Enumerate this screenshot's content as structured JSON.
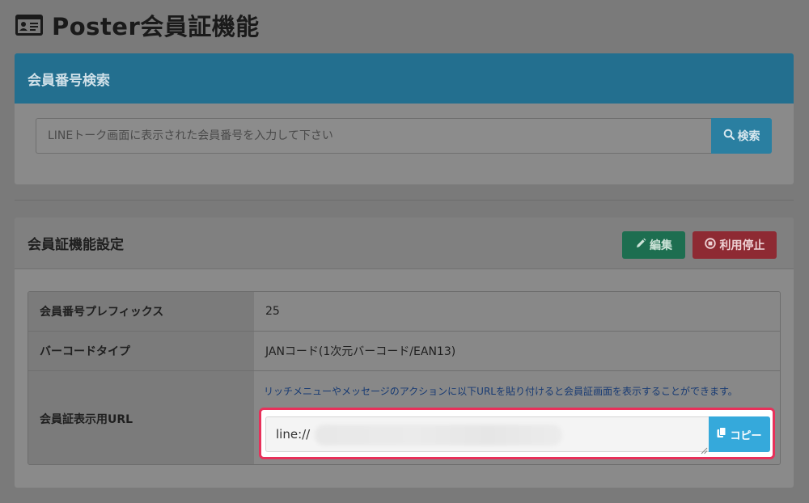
{
  "page": {
    "title": "Poster会員証機能",
    "icon": "id-card-icon"
  },
  "search": {
    "header": "会員番号検索",
    "placeholder": "LINEトーク画面に表示された会員番号を入力して下さい",
    "value": "",
    "button_label": "検索",
    "button_icon": "search-icon"
  },
  "settings": {
    "header": "会員証機能設定",
    "edit_label": "編集",
    "edit_icon": "pencil-icon",
    "stop_label": "利用停止",
    "stop_icon": "stop-circle-icon",
    "rows": [
      {
        "label": "会員番号プレフィックス",
        "value": "25"
      },
      {
        "label": "バーコードタイプ",
        "value": "JANコード(1次元バーコード/EAN13)"
      },
      {
        "label": "会員証表示用URL",
        "hint": "リッチメニューやメッセージのアクションに以下URLを貼り付けると会員証画面を表示することができます。",
        "url_value": "line://",
        "copy_label": "コピー",
        "copy_icon": "copy-icon"
      }
    ]
  },
  "colors": {
    "search_header": "#236f8f",
    "search_button": "#2a7fa1",
    "edit_button": "#1d6e50",
    "stop_button": "#8e2a33",
    "copy_button": "#35a9db",
    "highlight_border": "#e8305a"
  }
}
